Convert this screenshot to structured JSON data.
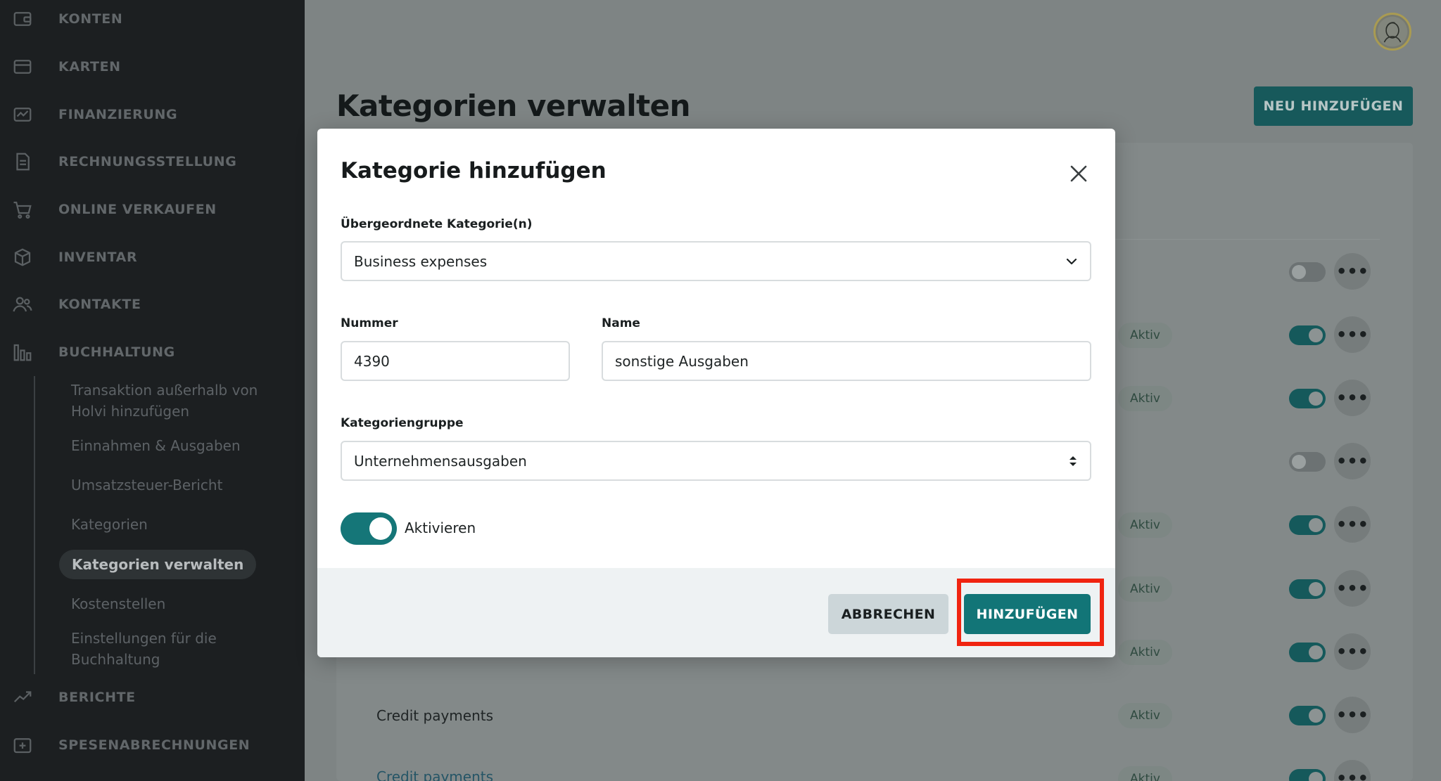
{
  "sidebar": {
    "items": [
      {
        "label": "KONTEN",
        "icon": "wallet-icon"
      },
      {
        "label": "KARTEN",
        "icon": "credit-card-icon"
      },
      {
        "label": "FINANZIERUNG",
        "icon": "financing-icon"
      },
      {
        "label": "RECHNUNGSSTELLUNG",
        "icon": "invoice-icon"
      },
      {
        "label": "ONLINE VERKAUFEN",
        "icon": "shopping-cart-icon"
      },
      {
        "label": "INVENTAR",
        "icon": "box-icon"
      },
      {
        "label": "KONTAKTE",
        "icon": "contacts-icon"
      },
      {
        "label": "BUCHHALTUNG",
        "icon": "bar-chart-icon"
      },
      {
        "label": "BERICHTE",
        "icon": "trend-icon"
      },
      {
        "label": "SPESENABRECHNUNGEN",
        "icon": "expense-icon"
      }
    ],
    "subitems": [
      {
        "label": "Transaktion außerhalb von Holvi hinzufügen"
      },
      {
        "label": "Einnahmen & Ausgaben"
      },
      {
        "label": "Umsatzsteuer-Bericht"
      },
      {
        "label": "Kategorien"
      },
      {
        "label": "Kategorien verwalten",
        "active": true
      },
      {
        "label": "Kostenstellen"
      },
      {
        "label": "Einstellungen für die Buchhaltung"
      }
    ]
  },
  "page": {
    "title": "Kategorien verwalten",
    "new_button": "NEU HINZUFÜGEN"
  },
  "background_rows": {
    "badge_label": "Aktiv",
    "row_label": "Credit payments",
    "link_label": "Credit payments"
  },
  "modal": {
    "title": "Kategorie hinzufügen",
    "parent_label": "Übergeordnete Kategorie(n)",
    "parent_value": "Business expenses",
    "number_label": "Nummer",
    "number_value": "4390",
    "name_label": "Name",
    "name_value": "sonstige Ausgaben",
    "group_label": "Kategoriengruppe",
    "group_value": "Unternehmensausgaben",
    "activate_label": "Aktivieren",
    "cancel_label": "ABBRECHEN",
    "add_label": "HINZUFÜGEN"
  },
  "colors": {
    "accent": "#127577",
    "highlight": "#f02410",
    "sidebar_bg": "#1c1f21"
  }
}
